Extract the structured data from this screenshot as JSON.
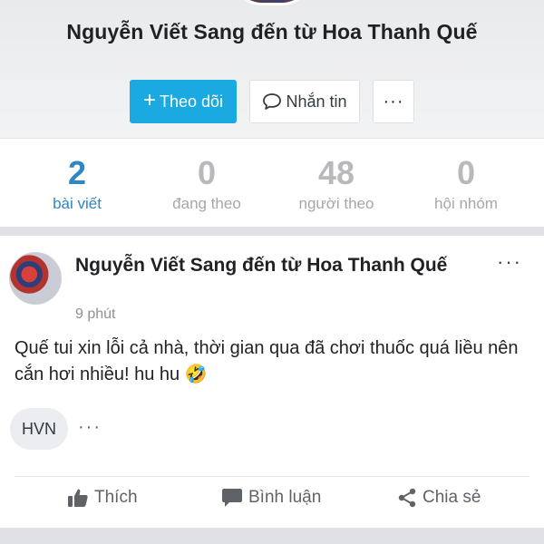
{
  "profile": {
    "name": "Nguyễn Viết Sang đến từ Hoa Thanh Quế",
    "follow_label": "Theo dõi",
    "message_label": "Nhắn tin",
    "more_label": "···"
  },
  "stats": [
    {
      "value": "2",
      "label": "bài viết"
    },
    {
      "value": "0",
      "label": "đang theo"
    },
    {
      "value": "48",
      "label": "người theo"
    },
    {
      "value": "0",
      "label": "hội nhóm"
    }
  ],
  "post": {
    "author": "Nguyễn Viết Sang đến từ Hoa Thanh Quế",
    "time": "9 phút",
    "text": "Quế tui xin lỗi cả nhà, thời gian qua đã chơi thuốc quá liều nên cắn hơi nhiều! hu hu 🤣",
    "tag": "HVN",
    "menu_label": "···",
    "tag_more_label": "···",
    "actions": {
      "like": "Thích",
      "comment": "Bình luận",
      "share": "Chia sẻ"
    }
  },
  "colors": {
    "accent": "#1ba9e2",
    "active_stat": "#2f86c3"
  }
}
